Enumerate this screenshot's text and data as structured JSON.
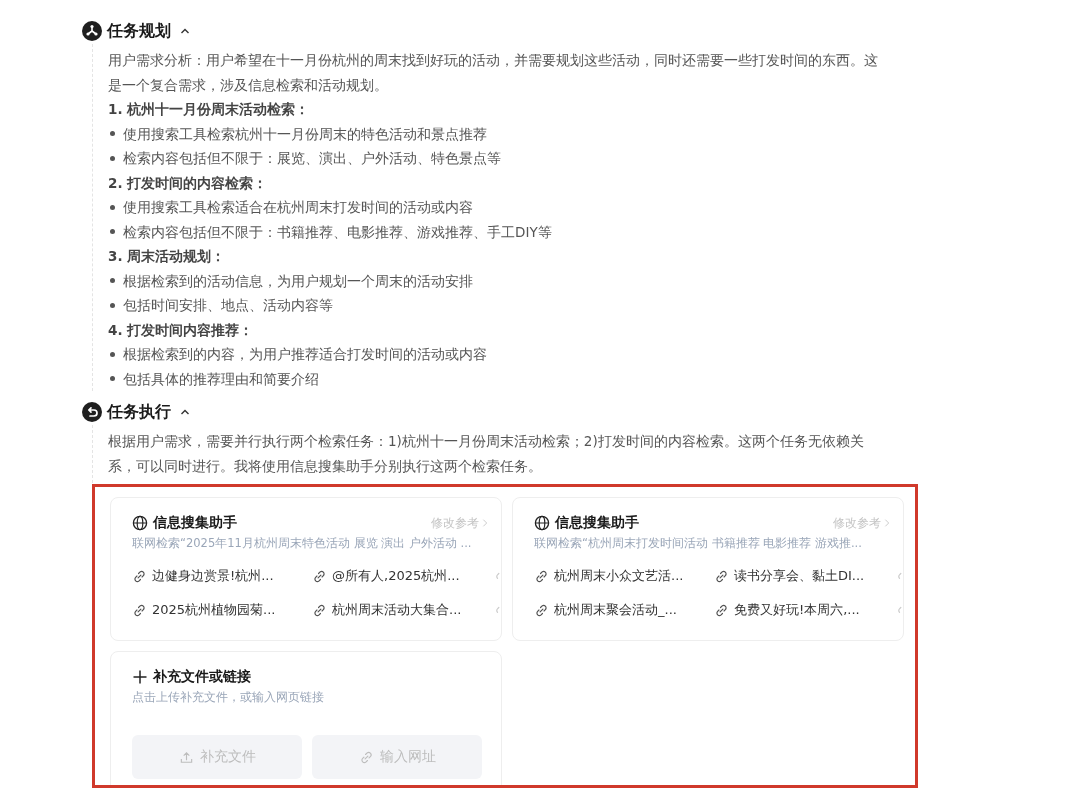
{
  "sections": [
    {
      "title": "任务规划",
      "kind": "planning",
      "expanded": true,
      "body": [
        {
          "kind": "text",
          "text": "用户需求分析：用户希望在十一月份杭州的周末找到好玩的活动，并需要规划这些活动，同时还需要一些打发时间的东西。这是一个复合需求，涉及信息检索和活动规划。"
        },
        {
          "kind": "heading",
          "text": "1. 杭州十一月份周末活动检索："
        },
        {
          "kind": "bullet",
          "text": "使用搜索工具检索杭州十一月份周末的特色活动和景点推荐"
        },
        {
          "kind": "bullet",
          "text": "检索内容包括但不限于：展览、演出、户外活动、特色景点等"
        },
        {
          "kind": "heading",
          "text": "2. 打发时间的内容检索："
        },
        {
          "kind": "bullet",
          "text": "使用搜索工具检索适合在杭州周末打发时间的活动或内容"
        },
        {
          "kind": "bullet",
          "text": "检索内容包括但不限于：书籍推荐、电影推荐、游戏推荐、手工DIY等"
        },
        {
          "kind": "heading",
          "text": "3. 周末活动规划："
        },
        {
          "kind": "bullet",
          "text": "根据检索到的活动信息，为用户规划一个周末的活动安排"
        },
        {
          "kind": "bullet",
          "text": "包括时间安排、地点、活动内容等"
        },
        {
          "kind": "heading",
          "text": "4. 打发时间内容推荐："
        },
        {
          "kind": "bullet",
          "text": "根据检索到的内容，为用户推荐适合打发时间的活动或内容"
        },
        {
          "kind": "bullet",
          "text": "包括具体的推荐理由和简要介绍"
        }
      ]
    },
    {
      "title": "任务执行",
      "kind": "execution",
      "expanded": true,
      "body": [
        {
          "kind": "text",
          "text": "根据用户需求，需要并行执行两个检索任务：1)杭州十一月份周末活动检索；2)打发时间的内容检索。这两个任务无依赖关系，可以同时进行。我将使用信息搜集助手分别执行这两个检索任务。"
        }
      ],
      "highlighted": true,
      "agents": [
        {
          "name": "信息搜集助手",
          "action": "修改参考",
          "query": "联网检索“2025年11月杭州周末特色活动 展览 演出 户外活动 ...",
          "links": [
            "边健身边赏景!杭州...",
            "@所有人,2025杭州...",
            "2025杭州植物园菊...",
            "杭州周末活动大集合..."
          ]
        },
        {
          "name": "信息搜集助手",
          "action": "修改参考",
          "query": "联网检索“杭州周末打发时间活动 书籍推荐 电影推荐 游戏推...",
          "links": [
            "杭州周末小众文艺活...",
            "读书分享会、黏土DI...",
            "杭州周末聚会活动_...",
            "免费又好玩!本周六,..."
          ]
        }
      ],
      "supplement": {
        "title": "补充文件或链接",
        "hint": "点击上传补充文件，或输入网页链接",
        "buttons": [
          {
            "label": "补充文件",
            "kind": "upload",
            "disabled": true
          },
          {
            "label": "输入网址",
            "kind": "link",
            "disabled": true
          }
        ]
      }
    }
  ]
}
